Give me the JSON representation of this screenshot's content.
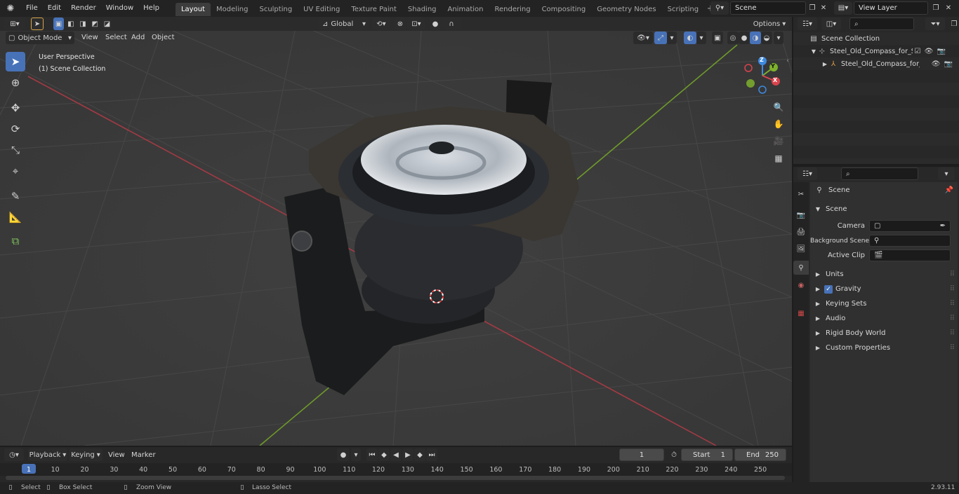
{
  "topbar": {
    "menus": [
      "File",
      "Edit",
      "Render",
      "Window",
      "Help"
    ],
    "workspaces": [
      "Layout",
      "Modeling",
      "Sculpting",
      "UV Editing",
      "Texture Paint",
      "Shading",
      "Animation",
      "Rendering",
      "Compositing",
      "Geometry Nodes",
      "Scripting"
    ],
    "active_workspace": "Layout",
    "scene_name": "Scene",
    "view_layer": "View Layer"
  },
  "viewport_header": {
    "transform_orientation": "Global",
    "options_label": "Options",
    "mode": "Object Mode",
    "menus": [
      "View",
      "Select",
      "Add",
      "Object"
    ]
  },
  "viewport": {
    "perspective_label": "User Perspective",
    "collection_label": "(1) Scene Collection",
    "gizmo_axes": {
      "z": "Z",
      "y": "Y",
      "x": "X"
    }
  },
  "outliner": {
    "root": "Scene Collection",
    "items": [
      {
        "label": "Steel_Old_Compass_for_Ship_"
      },
      {
        "label": "Steel_Old_Compass_for_"
      }
    ]
  },
  "properties": {
    "breadcrumb": "Scene",
    "section": "Scene",
    "fields": [
      {
        "label": "Camera",
        "value": ""
      },
      {
        "label": "Background Scene",
        "value": ""
      },
      {
        "label": "Active Clip",
        "value": ""
      }
    ],
    "panels": [
      "Units",
      "Gravity",
      "Keying Sets",
      "Audio",
      "Rigid Body World",
      "Custom Properties"
    ]
  },
  "timeline": {
    "menus": [
      "Playback",
      "Keying",
      "View",
      "Marker"
    ],
    "current_frame": "1",
    "start_label": "Start",
    "start_value": "1",
    "end_label": "End",
    "end_value": "250",
    "ruler": [
      "1",
      "10",
      "20",
      "30",
      "40",
      "50",
      "60",
      "70",
      "80",
      "90",
      "100",
      "110",
      "120",
      "130",
      "140",
      "150",
      "160",
      "170",
      "180",
      "190",
      "200",
      "210",
      "220",
      "230",
      "240",
      "250"
    ]
  },
  "statusbar": {
    "items": [
      "Select",
      "Box Select",
      "Zoom View",
      "Lasso Select"
    ],
    "version": "2.93.11"
  },
  "colors": {
    "accent": "#4872b8",
    "x_axis": "#d9434d",
    "y_axis": "#7eb02d",
    "z_axis": "#3d8ae0"
  }
}
